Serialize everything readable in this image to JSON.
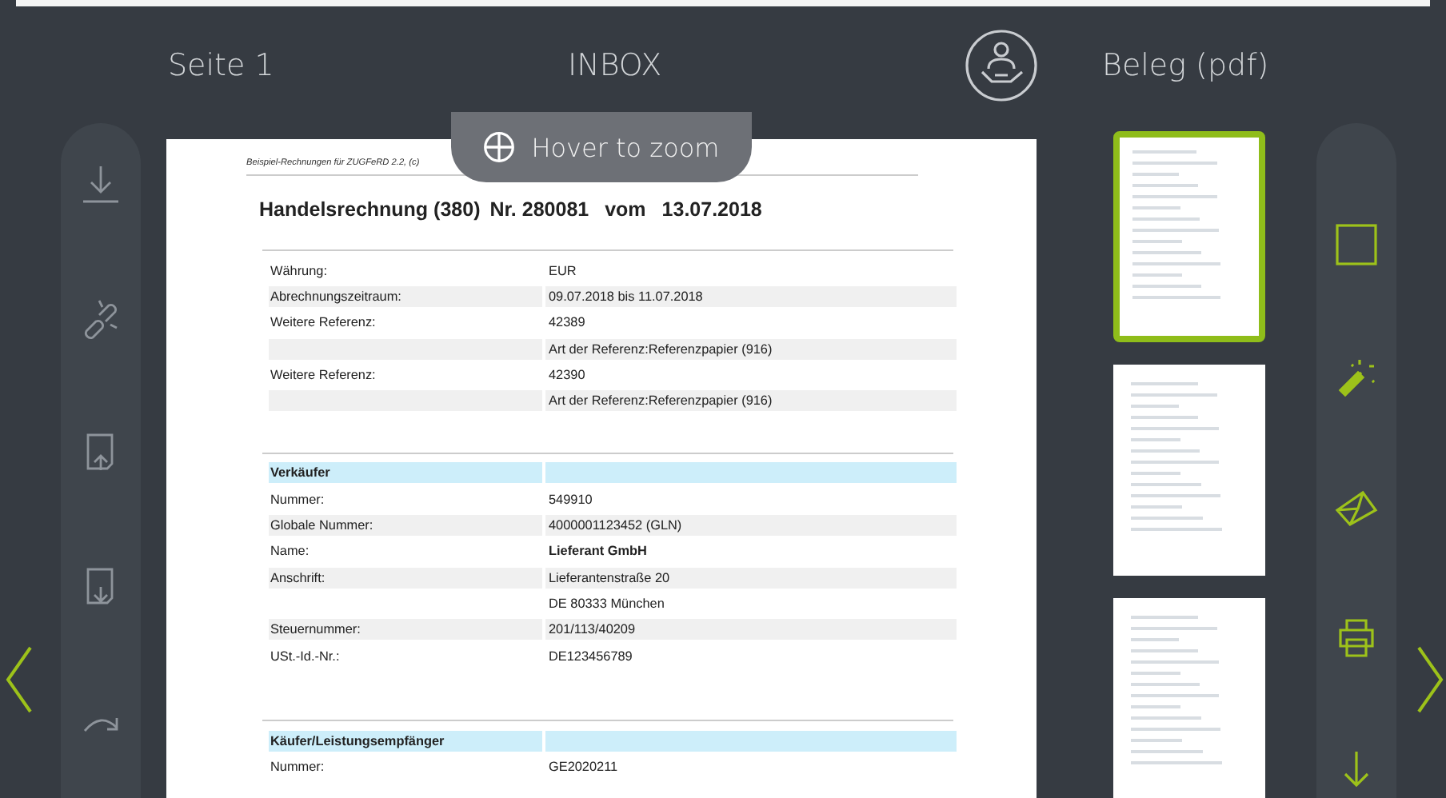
{
  "header": {
    "page_label": "Seite 1",
    "folder": "INBOX",
    "document_type": "Beleg (pdf)"
  },
  "left_toolbar": [
    {
      "kind": "download"
    },
    {
      "kind": "unlink"
    },
    {
      "kind": "page-up"
    },
    {
      "kind": "page-down"
    },
    {
      "kind": "redo"
    }
  ],
  "right_toolbar": [
    {
      "kind": "square"
    },
    {
      "kind": "wand"
    },
    {
      "kind": "envelope"
    },
    {
      "kind": "printer"
    },
    {
      "kind": "arrow-down"
    }
  ],
  "zoom_hint": "Hover to zoom",
  "document": {
    "note": "Beispiel-Rechnungen für ZUGFeRD 2.2, (c)",
    "title": "Handelsrechnung (380)",
    "number": "Nr. 280081",
    "date_word": "vom",
    "date": "13.07.2018",
    "sections": [
      {
        "rows": [
          {
            "label": "Währung:",
            "value": "EUR",
            "bold": false
          },
          {
            "label": "Abrechnungszeitraum:",
            "value": "09.07.2018 bis 11.07.2018",
            "bold": false
          },
          {
            "label": "Weitere Referenz:",
            "value": "42389",
            "bold": false
          },
          {
            "label": null,
            "value": "Art der Referenz:Referenzpapier (916)",
            "bold": false
          },
          {
            "label": "Weitere Referenz:",
            "value": "42390",
            "bold": false
          },
          {
            "label": null,
            "value": "Art der Referenz:Referenzpapier (916)",
            "bold": false
          }
        ]
      },
      {
        "heading": "Verkäufer",
        "rows": [
          {
            "label": "Nummer:",
            "value": "549910",
            "bold": false
          },
          {
            "label": "Globale Nummer:",
            "value": "4000001123452  (GLN)",
            "bold": false
          },
          {
            "label": "Name:",
            "value": "Lieferant GmbH",
            "bold": true
          },
          {
            "label": "Anschrift:",
            "value": "Lieferantenstraße 20",
            "bold": false
          },
          {
            "label": null,
            "value": "DE 80333 München",
            "bold": false
          },
          {
            "label": "Steuernummer:",
            "value": "201/113/40209",
            "bold": false
          },
          {
            "label": "USt.-Id.-Nr.:",
            "value": "DE123456789",
            "bold": false
          }
        ]
      },
      {
        "heading": "Käufer/Leistungsempfänger",
        "rows": [
          {
            "label": "Nummer:",
            "value": "GE2020211",
            "bold": false
          }
        ]
      }
    ]
  },
  "thumbnails": [
    {
      "selected": true
    },
    {
      "selected": false
    },
    {
      "selected": false
    }
  ]
}
